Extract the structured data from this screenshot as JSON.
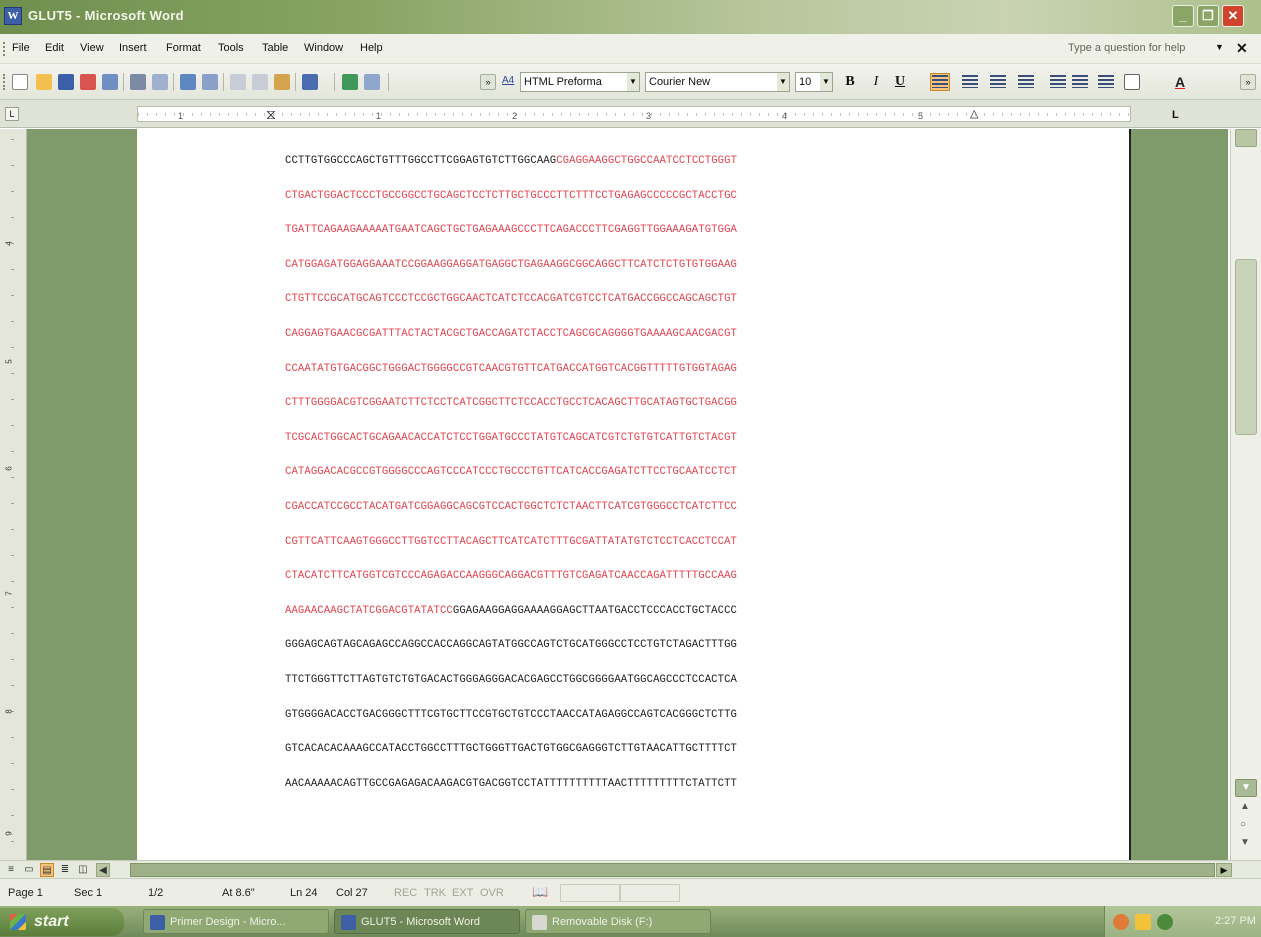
{
  "window": {
    "title": "GLUT5 - Microsoft Word",
    "controls": {
      "minimize": "_",
      "maximize": "❐",
      "close": "✕"
    }
  },
  "menubar": {
    "items": [
      "File",
      "Edit",
      "View",
      "Insert",
      "Format",
      "Tools",
      "Table",
      "Window",
      "Help"
    ],
    "help_placeholder": "Type a question for help",
    "close_glyph": "✕"
  },
  "toolbar": {
    "style_value": "HTML Preforma",
    "style_indicator": "A4",
    "font_value": "Courier New",
    "size_value": "10",
    "bold_label": "B",
    "italic_label": "I",
    "underline_label": "U",
    "font_color_label": "A"
  },
  "ruler": {
    "ticks": [
      "1",
      "1",
      "2",
      "3",
      "4",
      "5"
    ],
    "corner_glyph": "L"
  },
  "vertical_ruler": {
    "numbers": [
      "4",
      "5",
      "6",
      "7",
      "8",
      "9"
    ]
  },
  "document": {
    "lines": [
      {
        "black": "CCTTGTGGCCCAGCTGTTTGGCCTTCGGAGTGTCTTGGCAAG",
        "red": "CGAGGAAGGCTGGCCAATCCTCCTGGGT",
        "black2": ""
      },
      {
        "black": "",
        "red": "CTGACTGGACTCCCTGCCGGCCTGCAGCTCCTCTTGCTGCCCTTCTTTCCTGAGAGCCCCCGCTACCTGC",
        "black2": ""
      },
      {
        "black": "",
        "red": "TGATTCAGAAGAAAAATGAATCAGCTGCTGAGAAAGCCCTTCAGACCCTTCGAGGTTGGAAAGATGTGGA",
        "black2": ""
      },
      {
        "black": "",
        "red": "CATGGAGATGGAGGAAATCCGGAAGGAGGATGAGGCTGAGAAGGCGGCAGGCTTCATCTCTGTGTGGAAG",
        "black2": ""
      },
      {
        "black": "",
        "red": "CTGTTCCGCATGCAGTCCCTCCGCTGGCAACTCATCTCCACGATCGTCCTCATGACCGGCCAGCAGCTGT",
        "black2": ""
      },
      {
        "black": "",
        "red": "CAGGAGTGAACGCGATTTACTACTACGCTGACCAGATCTACCTCAGCGCAGGGGTGAAAAGCAACGACGT",
        "black2": ""
      },
      {
        "black": "",
        "red": "CCAATATGTGACGGCTGGGACTGGGGCCGTCAACGTGTTCATGACCATGGTCACGGTTTTTGTGGTAGAG",
        "black2": ""
      },
      {
        "black": "",
        "red": "CTTTGGGGACGTCGGAATCTTCTCCTCATCGGCTTCTCCACCTGCCTCACAGCTTGCATAGTGCTGACGG",
        "black2": ""
      },
      {
        "black": "",
        "red": "TCGCACTGGCACTGCAGAACACCATCTCCTGGATGCCCTATGTCAGCATCGTCTGTGTCATTGTCTACGT",
        "black2": ""
      },
      {
        "black": "",
        "red": "CATAGGACACGCCGTGGGGCCCAGTCCCATCCCTGCCCTGTTCATCACCGAGATCTTCCTGCAATCCTCT",
        "black2": ""
      },
      {
        "black": "",
        "red": "CGACCATCCGCCTACATGATCGGAGGCAGCGTCCACTGGCTCTCTAACTTCATCGTGGGCCTCATCTTCC",
        "black2": ""
      },
      {
        "black": "",
        "red": "CGTTCATTCAAGTGGGCCTTGGTCCTTACAGCTTCATCATCTTTGCGATTATATGTCTCCTCACCTCCAT",
        "black2": ""
      },
      {
        "black": "",
        "red": "CTACATCTTCATGGTCGTCCCAGAGACCAAGGGCAGGACGTTTGTCGAGATCAACCAGATTTTTGCCAAG",
        "black2": ""
      },
      {
        "black": "",
        "red": "AAGAACAAGCTATCGGACGTATATCC",
        "black2": "GGAGAAGGAGGAAAAGGAGCTTAATGACCTCCCACCTGCTACCC"
      },
      {
        "black": "GGGAGCAGTAGCAGAGCCAGGCCACCAGGCAGTATGGCCAGTCTGCATGGGCCTCCTGTCTAGACTTTGG",
        "red": "",
        "black2": ""
      },
      {
        "black": "TTCTGGGTTCTTAGTGTCTGTGACACTGGGAGGGACACGAGCCTGGCGGGGAATGGCAGCCCTCCACTCA",
        "red": "",
        "black2": ""
      },
      {
        "black": "GTGGGGACACCTGACGGGCTTTCGTGCTTCCGTGCTGTCCCTAACCATAGAGGCCAGTCACGGGCTCTTG",
        "red": "",
        "black2": ""
      },
      {
        "black": "GTCACACACAAAGCCATACCTGGCCTTTGCTGGGTTGACTGTGGCGAGGGTCTTGTAACATTGCTTTTCT",
        "red": "",
        "black2": ""
      },
      {
        "black": "AACAAAAACAGTTGCCGAGAGACAAGACGTGACGGTCCTATTTTTTTTTTAACTTTTTTTTTCTATTCTT",
        "red": "",
        "black2": ""
      }
    ]
  },
  "statusbar": {
    "page": "Page 1",
    "sec": "Sec 1",
    "pages": "1/2",
    "at": "At 8.6\"",
    "ln": "Ln 24",
    "col": "Col 27",
    "rec": "REC",
    "trk": "TRK",
    "ext": "EXT",
    "ovr": "OVR"
  },
  "taskbar": {
    "start_label": "start",
    "tasks": [
      "Primer Design - Micro...",
      "GLUT5 - Microsoft Word",
      "Removable Disk (F:)"
    ],
    "clock": "2:27 PM"
  },
  "colors": {
    "red_sequence": "#e8434f",
    "black_sequence": "#222222",
    "workspace": "#7f9a6b",
    "active_button": "#f6c57d"
  }
}
